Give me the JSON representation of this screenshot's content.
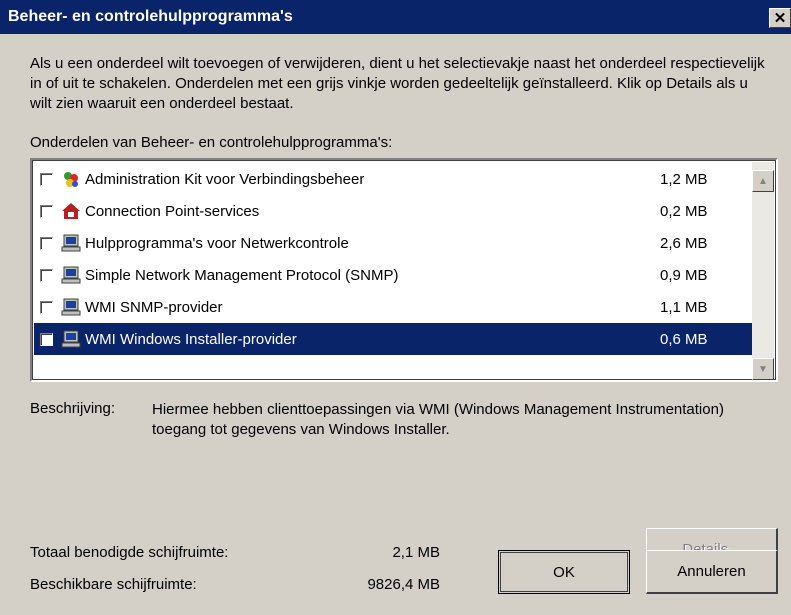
{
  "window": {
    "title": "Beheer- en controlehulpprogramma's",
    "close_icon": "close-icon"
  },
  "intro_text": "Als u een onderdeel wilt toevoegen of verwijderen, dient u het selectievakje naast het onderdeel respectievelijk in of uit te schakelen. Onderdelen met een grijs vinkje worden gedeeltelijk geïnstalleerd. Klik op Details als u wilt zien waaruit een onderdeel bestaat.",
  "list_label": "Onderdelen van Beheer- en controlehulpprogramma's:",
  "components": [
    {
      "name": "Administration Kit voor Verbindingsbeheer",
      "size": "1,2 MB",
      "icon": "cmak-icon",
      "checked": false
    },
    {
      "name": "Connection Point-services",
      "size": "0,2 MB",
      "icon": "connection-point-icon",
      "checked": false
    },
    {
      "name": "Hulpprogramma's voor Netwerkcontrole",
      "size": "2,6 MB",
      "icon": "computer-icon",
      "checked": false
    },
    {
      "name": "Simple Network Management Protocol (SNMP)",
      "size": "0,9 MB",
      "icon": "computer-icon",
      "checked": false
    },
    {
      "name": "WMI SNMP-provider",
      "size": "1,1 MB",
      "icon": "computer-icon",
      "checked": false
    },
    {
      "name": "WMI Windows Installer-provider",
      "size": "0,6 MB",
      "icon": "computer-icon",
      "checked": false,
      "selected": true
    }
  ],
  "description": {
    "label": "Beschrijving:",
    "text": "Hiermee hebben clienttoepassingen via WMI (Windows Management Instrumentation) toegang tot gegevens van Windows Installer."
  },
  "space": {
    "total_label": "Totaal benodigde schijfruimte:",
    "total_value": "2,1 MB",
    "available_label": "Beschikbare schijfruimte:",
    "available_value": "9826,4 MB"
  },
  "buttons": {
    "details": "Details...",
    "ok": "OK",
    "cancel": "Annuleren"
  },
  "colors": {
    "selection": "#0a246a",
    "face": "#d4d0c8"
  }
}
